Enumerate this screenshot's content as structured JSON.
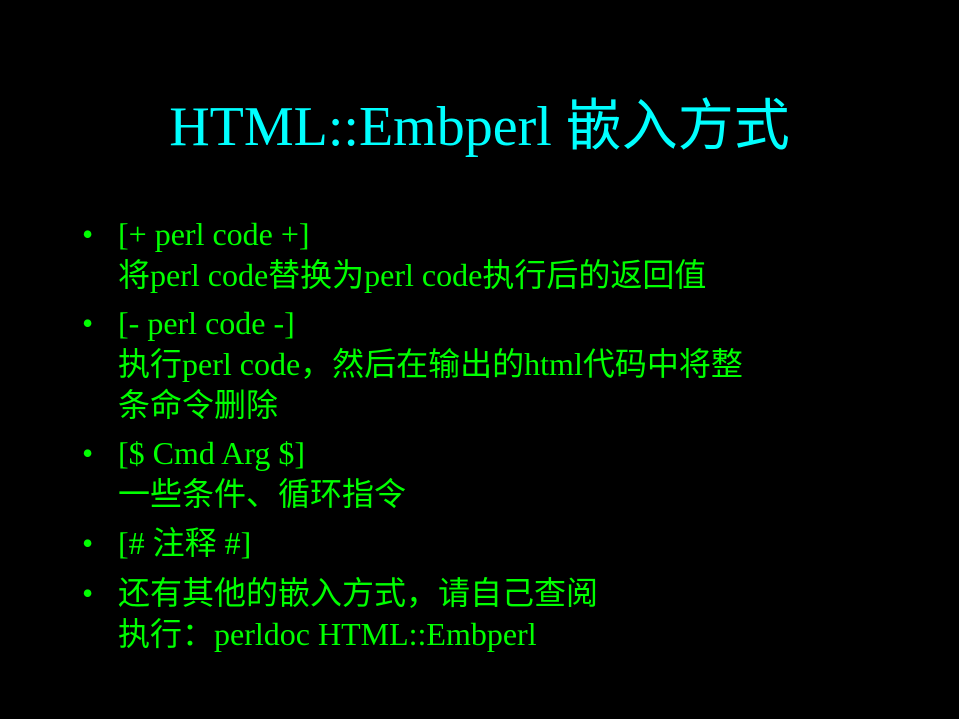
{
  "slide": {
    "title": "HTML::Embperl 嵌入方式",
    "bullet_glyph": "•",
    "colors": {
      "background": "#000000",
      "title": "#00ffff",
      "text": "#00ff00"
    },
    "items": [
      {
        "lines": [
          "[+ perl code +]",
          "将perl code替换为perl code执行后的返回值"
        ]
      },
      {
        "lines": [
          "[- perl code -]",
          "执行perl code，然后在输出的html代码中将整",
          "条命令删除"
        ]
      },
      {
        "lines": [
          "[$ Cmd Arg $]",
          "一些条件、循环指令"
        ]
      },
      {
        "lines": [
          "[# 注释 #]"
        ]
      },
      {
        "lines": [
          "还有其他的嵌入方式，请自己查阅",
          "执行：perldoc HTML::Embperl"
        ]
      }
    ]
  }
}
